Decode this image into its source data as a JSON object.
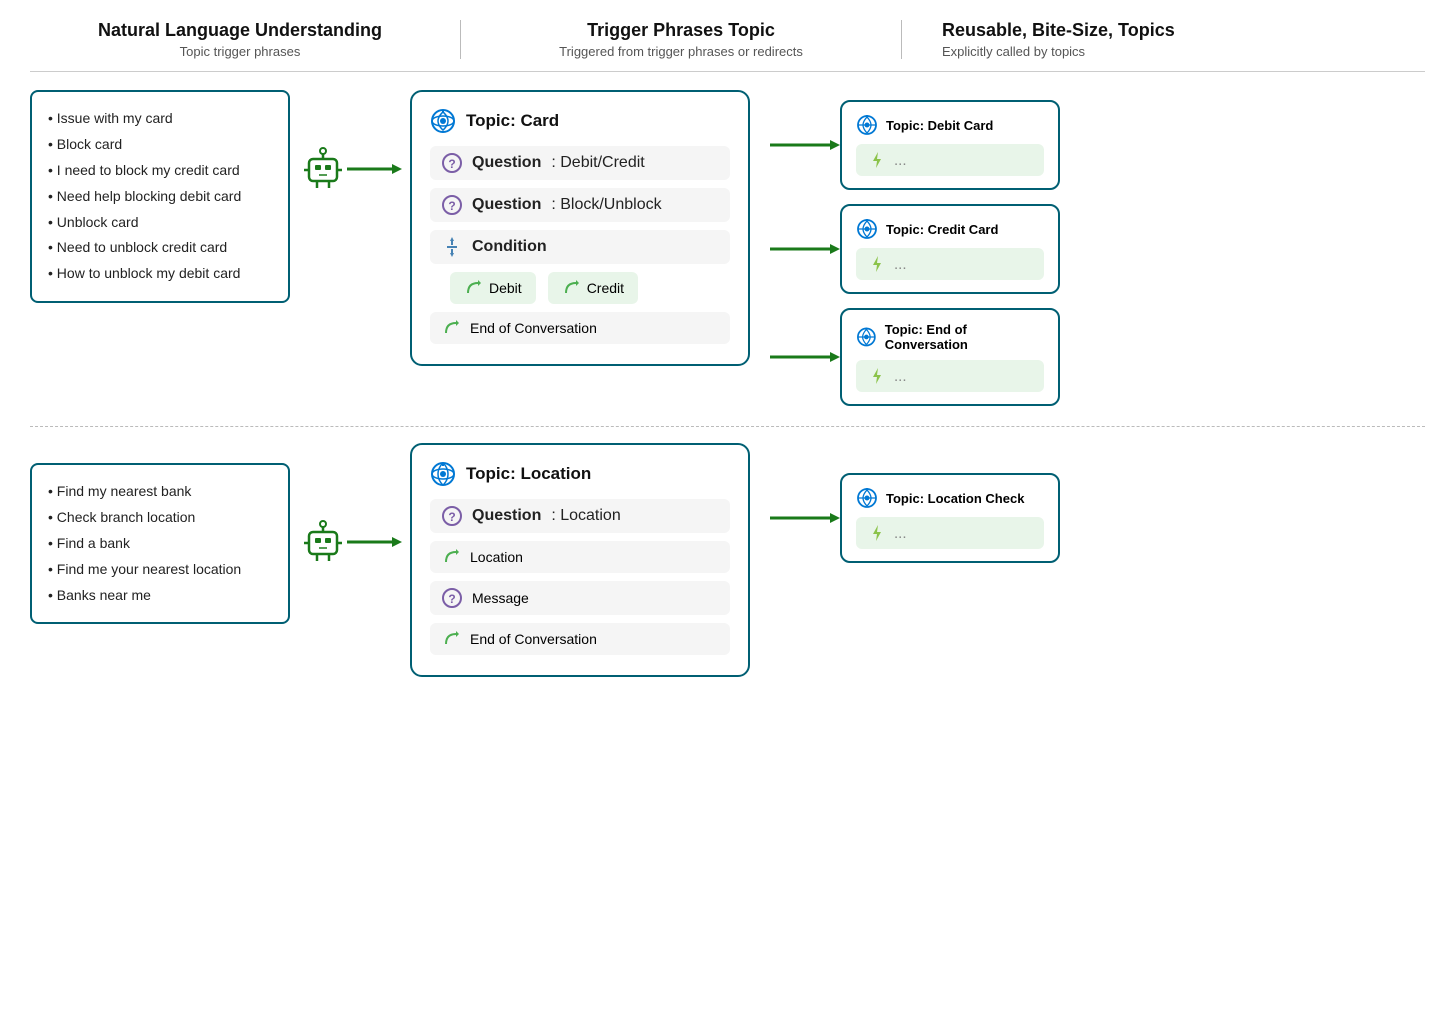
{
  "headers": {
    "col1": {
      "main": "Natural Language Understanding",
      "sub": "Topic trigger phrases"
    },
    "col2": {
      "main": "Trigger Phrases Topic",
      "sub": "Triggered from trigger phrases or redirects"
    },
    "col3": {
      "main": "Reusable, Bite-Size, Topics",
      "sub": "Explicitly called by topics"
    }
  },
  "top_row": {
    "phrases": [
      "Issue with my card",
      "Block card",
      "I need to block my credit card",
      "Need help blocking debit card",
      "Unblock card",
      "Need to unblock credit card",
      "How to unblock my debit card"
    ],
    "trigger_topic": {
      "title": "Topic: Card",
      "items": [
        {
          "type": "question",
          "label": "Question",
          "value": "Debit/Credit"
        },
        {
          "type": "question",
          "label": "Question",
          "value": "Block/Unblock"
        },
        {
          "type": "condition",
          "label": "Condition"
        },
        {
          "type": "branch_debit",
          "label": "Debit"
        },
        {
          "type": "branch_credit",
          "label": "Credit"
        },
        {
          "type": "redirect",
          "label": "End of Conversation"
        }
      ]
    },
    "reusable_topics": [
      {
        "title": "Topic: Debit Card",
        "content": "..."
      },
      {
        "title": "Topic: Credit Card",
        "content": "..."
      },
      {
        "title": "Topic: End of Conversation",
        "content": "..."
      }
    ]
  },
  "bottom_row": {
    "phrases": [
      "Find my nearest bank",
      "Check branch location",
      "Find a bank",
      "Find me your nearest location",
      "Banks near me"
    ],
    "trigger_topic": {
      "title": "Topic: Location",
      "items": [
        {
          "type": "question",
          "label": "Question",
          "value": "Location"
        },
        {
          "type": "redirect",
          "label": "Location"
        },
        {
          "type": "question",
          "label": "Message"
        },
        {
          "type": "redirect",
          "label": "End of Conversation"
        }
      ]
    },
    "reusable_topics": [
      {
        "title": "Topic: Location Check",
        "content": "..."
      }
    ]
  }
}
